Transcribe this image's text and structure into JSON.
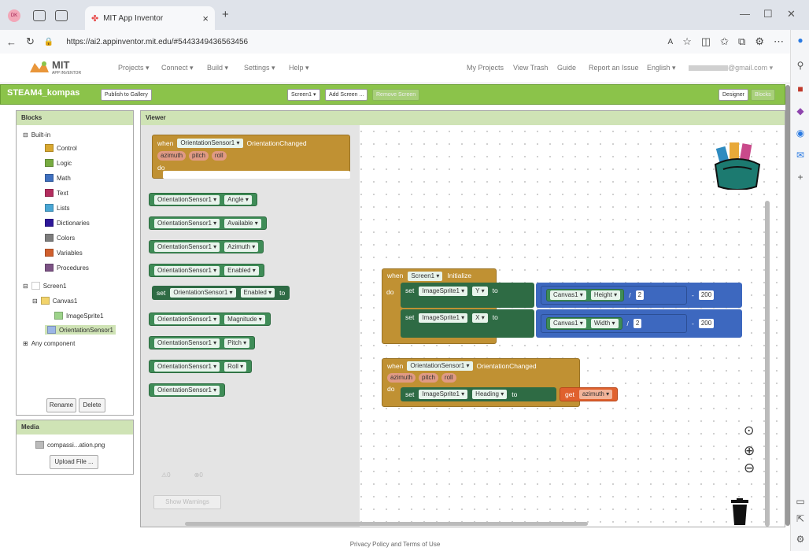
{
  "browser": {
    "profile": "DK",
    "tab_title": "MIT App Inventor",
    "url": "https://ai2.appinventor.mit.edu/#5443349436563456"
  },
  "header": {
    "logo_title": "MIT",
    "logo_sub": "APP INVENTOR",
    "menus": [
      "Projects ▾",
      "Connect ▾",
      "Build ▾",
      "Settings ▾",
      "Help ▾"
    ],
    "right_links": [
      "My Projects",
      "View Trash",
      "Guide",
      "Report an Issue",
      "English ▾",
      "@gmail.com ▾"
    ]
  },
  "toolbar": {
    "project_name": "STEAM4_kompas",
    "publish": "Publish to Gallery",
    "screen": "Screen1 ▾",
    "add_screen": "Add Screen ...",
    "remove_screen": "Remove Screen",
    "designer": "Designer",
    "blocks": "Blocks"
  },
  "blocks_panel": {
    "title": "Blocks",
    "builtin": "Built-in",
    "items": [
      {
        "label": "Control",
        "color": "#d9a830"
      },
      {
        "label": "Logic",
        "color": "#77ab41"
      },
      {
        "label": "Math",
        "color": "#3f70bf"
      },
      {
        "label": "Text",
        "color": "#b32d5e"
      },
      {
        "label": "Lists",
        "color": "#49a6d4"
      },
      {
        "label": "Dictionaries",
        "color": "#2d1799"
      },
      {
        "label": "Colors",
        "color": "#7d7d7d"
      },
      {
        "label": "Variables",
        "color": "#d05f2d"
      },
      {
        "label": "Procedures",
        "color": "#7c5385"
      }
    ],
    "screen": "Screen1",
    "canvas": "Canvas1",
    "sprite": "ImageSprite1",
    "sensor": "OrientationSensor1",
    "any": "Any component",
    "rename": "Rename",
    "delete": "Delete"
  },
  "media": {
    "title": "Media",
    "file": "compassi...ation.png",
    "upload": "Upload File ..."
  },
  "viewer": {
    "title": "Viewer",
    "flyout": {
      "when": "when",
      "component": "OrientationSensor1 ▾",
      "event": "OrientationChanged",
      "params": [
        "azimuth",
        "pitch",
        "roll"
      ],
      "do": "do",
      "getters": [
        "Angle ▾",
        "Available ▾",
        "Azimuth ▾",
        "Enabled ▾"
      ],
      "set": "set",
      "set_prop": "Enabled ▾",
      "to": "to",
      "getters2": [
        "Magnitude ▾",
        "Pitch ▾",
        "Roll ▾"
      ],
      "warnings_a": "0",
      "warnings_b": "0",
      "show_warnings": "Show Warnings"
    },
    "init": {
      "when": "when",
      "component": "Screen1 ▾",
      "event": "Initialize",
      "do": "do",
      "set": "set",
      "sprite": "ImageSprite1 ▾",
      "y": "Y ▾",
      "x": "X ▾",
      "to": "to",
      "canvas": "Canvas1 ▾",
      "height": "Height ▾",
      "width": "Width ▾",
      "div": "/",
      "two": "2",
      "minus": "-",
      "twohundred": "200"
    },
    "orient": {
      "when": "when",
      "component": "OrientationSensor1 ▾",
      "event": "OrientationChanged",
      "params": [
        "azimuth",
        "pitch",
        "roll"
      ],
      "do": "do",
      "set": "set",
      "sprite": "ImageSprite1 ▾",
      "heading": "Heading ▾",
      "to": "to",
      "get": "get",
      "azimuth": "azimuth ▾"
    }
  },
  "footer": "Privacy Policy and Terms of Use"
}
